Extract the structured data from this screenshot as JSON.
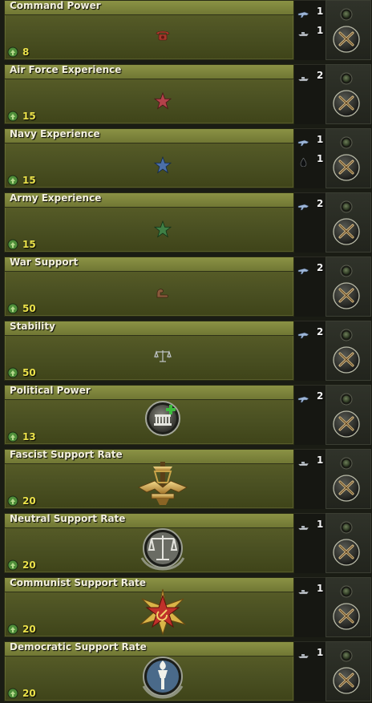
{
  "decisions": [
    {
      "title": "Command Power",
      "cost": "8",
      "emblem": "telephone-icon",
      "reqs": [
        {
          "icon": "plane-icon",
          "count": "1"
        },
        {
          "icon": "ship-icon",
          "count": "1"
        }
      ]
    },
    {
      "title": "Air Force Experience",
      "cost": "15",
      "emblem": "red-star-icon",
      "reqs": [
        {
          "icon": "ship-icon",
          "count": "2"
        }
      ]
    },
    {
      "title": "Navy Experience",
      "cost": "15",
      "emblem": "blue-star-icon",
      "reqs": [
        {
          "icon": "plane-icon",
          "count": "1"
        },
        {
          "icon": "oil-drop-icon",
          "count": "1"
        }
      ]
    },
    {
      "title": "Army Experience",
      "cost": "15",
      "emblem": "green-star-icon",
      "reqs": [
        {
          "icon": "plane-icon",
          "count": "2"
        }
      ]
    },
    {
      "title": "War Support",
      "cost": "50",
      "emblem": "flexed-arm-icon",
      "reqs": [
        {
          "icon": "plane-icon",
          "count": "2"
        }
      ]
    },
    {
      "title": "Stability",
      "cost": "50",
      "emblem": "scales-icon",
      "reqs": [
        {
          "icon": "plane-icon",
          "count": "2"
        }
      ]
    },
    {
      "title": "Political Power",
      "cost": "13",
      "emblem": "political-power-badge-icon",
      "reqs": [
        {
          "icon": "plane-icon",
          "count": "2"
        }
      ]
    },
    {
      "title": "Fascist Support Rate",
      "cost": "20",
      "emblem": "fascist-eagle-emblem-icon",
      "reqs": [
        {
          "icon": "ship-icon",
          "count": "1"
        }
      ]
    },
    {
      "title": "Neutral Support Rate",
      "cost": "20",
      "emblem": "neutral-scales-emblem-icon",
      "reqs": [
        {
          "icon": "ship-icon",
          "count": "1"
        }
      ]
    },
    {
      "title": "Communist Support Rate",
      "cost": "20",
      "emblem": "communist-star-emblem-icon",
      "reqs": [
        {
          "icon": "ship-icon",
          "count": "1"
        }
      ]
    },
    {
      "title": "Democratic Support Rate",
      "cost": "20",
      "emblem": "democratic-torch-emblem-icon",
      "reqs": [
        {
          "icon": "ship-icon",
          "count": "1"
        }
      ]
    }
  ],
  "colors": {
    "cost_text": "#ebe24a",
    "title_text": "#f3f0de",
    "panel": "#4f5524"
  }
}
